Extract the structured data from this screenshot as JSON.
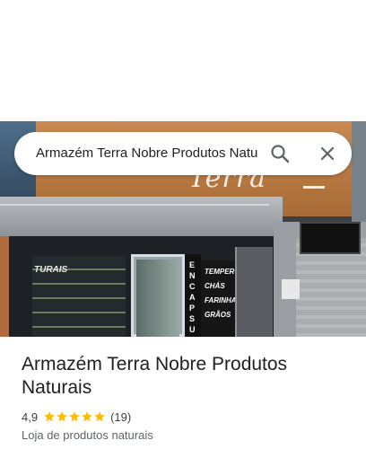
{
  "search": {
    "query": "Armazém Terra Nobre Produtos Naturais"
  },
  "photo": {
    "sign_text": "Terra Nobre",
    "shelf_label": "TURAIS",
    "side_panel_text": "ENCAPSU",
    "menu_items": [
      "TEMPEROS",
      "CHÁS",
      "FARINHAS",
      "GRÃOS"
    ]
  },
  "place": {
    "title": "Armazém Terra Nobre Produtos Naturais",
    "rating": "4,9",
    "rating_value": 4.9,
    "stars_max": 5,
    "reviews": "(19)",
    "category": "Loja de produtos naturais"
  },
  "colors": {
    "star": "#fbbc04",
    "title_text": "#202124",
    "secondary_text": "#5f6368"
  }
}
